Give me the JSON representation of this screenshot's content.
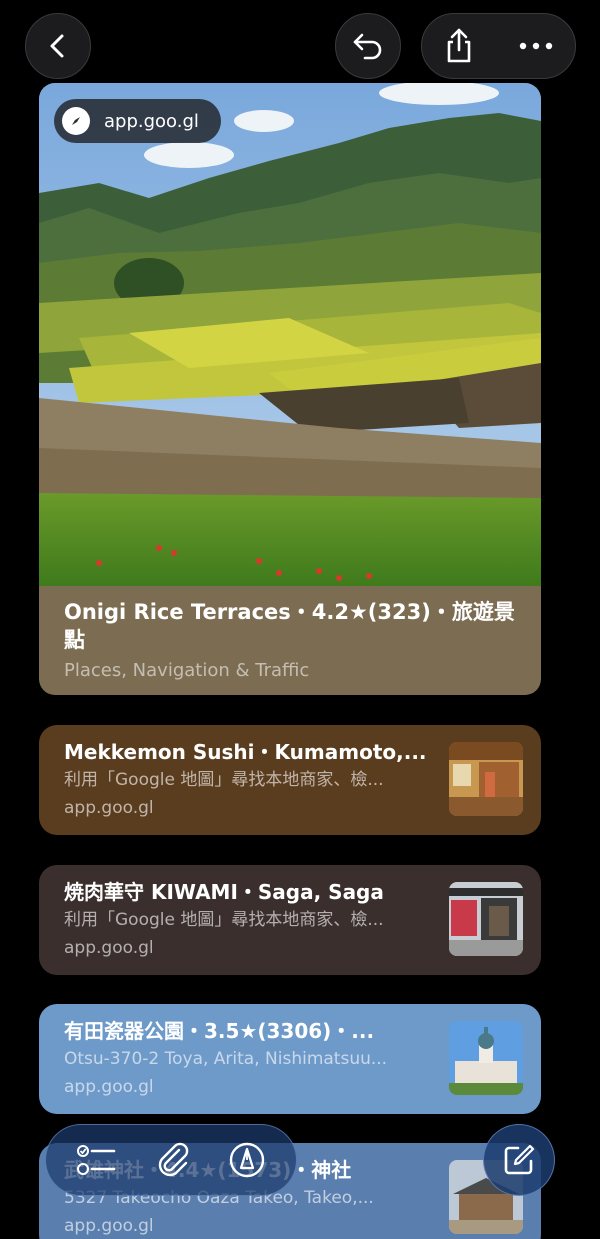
{
  "nav": {
    "back_icon": "chevron-left-icon",
    "undo_icon": "undo-arrow-icon",
    "share_icon": "share-icon",
    "more_icon": "ellipsis-icon"
  },
  "hero": {
    "url_chip": "app.goo.gl",
    "title": "Onigi Rice Terraces・4.2★(323)・旅遊景點",
    "subtitle": "Places, Navigation & Traffic",
    "bg_color": "#7c6d52"
  },
  "results": [
    {
      "title": "Mekkemon Sushi・Kumamoto,...",
      "desc": "利用「Google 地圖」尋找本地商家、檢...",
      "url": "app.goo.gl",
      "bg_color": "#5a3c1e"
    },
    {
      "title": "焼肉華守 KIWAMI・Saga, Saga",
      "desc": "利用「Google 地圖」尋找本地商家、檢...",
      "url": "app.goo.gl",
      "bg_color": "#3a2f2c"
    },
    {
      "title": "有田瓷器公園・3.5★(3306)・...",
      "desc": "Otsu-370-2 Toya, Arita, Nishimatsuu...",
      "url": "app.goo.gl",
      "bg_color": "#6e9ac9"
    },
    {
      "title": "武雄神社・4.4★(1573)・神社",
      "desc": "5327 Takeocho Oaza Takeo, Takeo,...",
      "url": "app.goo.gl",
      "bg_color": "#5a7fae"
    }
  ],
  "toolbar": {
    "checklist_icon": "checklist-icon",
    "attach_icon": "paperclip-icon",
    "markup_icon": "pen-markup-icon",
    "compose_icon": "compose-icon"
  }
}
